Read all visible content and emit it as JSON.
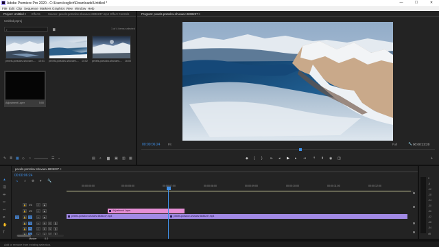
{
  "window": {
    "title": "Adobe Premiere Pro 2020 - C:\\Users\\xxglich\\Downloads\\Untitled *",
    "minimize_glyph": "—",
    "maximize_glyph": "☐",
    "close_glyph": "✕"
  },
  "menu": [
    "File",
    "Edit",
    "Clip",
    "Sequence",
    "Markers",
    "Graphics",
    "View",
    "Window",
    "Help"
  ],
  "project_panel": {
    "tabs": [
      "Project: Untitled ≡",
      "Effects",
      "Source: pexels-porsolov-shuvaev-6836237.mp4",
      "Effect Controls"
    ],
    "project_name": "Untitled.prproj",
    "items_count": "1 of 4 items selected",
    "items": [
      {
        "name": "pexels-porsolov-shuvaev-...",
        "duration": "10:01"
      },
      {
        "name": "pexels-porsolov-shuvaev-...",
        "duration": "14:02"
      },
      {
        "name": "pexels-porsolov-shuvaev-...",
        "duration": "16:00"
      },
      {
        "name": "Adjustment Layer",
        "duration": "5:00"
      }
    ]
  },
  "program_monitor": {
    "tab": "Program: pexels-porsolov-shuvaev-6836237 ≡",
    "timecode_left": "00:00:06:24",
    "fit": "Fit",
    "full": "Full",
    "timecode_right": "00:00:13:20"
  },
  "timeline": {
    "sequence_tab": "pexels-porsolov-shuvaev-6836237 ≡",
    "timecode": "00:00:06:24",
    "ruler_ticks": [
      "00:00:00:00",
      "00:00:05:00",
      "00:00:07:00",
      "00:00:08:00",
      "00:00:09:00",
      "00:00:10:00",
      "00:00:11:00",
      "00:00:12:00"
    ],
    "tracks": [
      {
        "name": "V3",
        "kind": "video"
      },
      {
        "name": "V2",
        "kind": "video"
      },
      {
        "name": "V1",
        "kind": "video"
      },
      {
        "name": "A1",
        "kind": "audio"
      },
      {
        "name": "A2",
        "kind": "audio"
      },
      {
        "name": "A3",
        "kind": "audio"
      }
    ],
    "master_label": "Master",
    "master_value": "0.0",
    "clips": {
      "adjustment": "Adjustment Layer",
      "v1_a": "pexels-porsolov-shuvaev-6836237.mp4",
      "v1_b": "pexels-porsolov-shuvaev-6836237.mp4"
    }
  },
  "tools": [
    "selection-tool",
    "track-select-tool",
    "ripple-edit-tool",
    "razor-tool",
    "slip-tool",
    "pen-tool",
    "hand-tool",
    "type-tool"
  ],
  "meter": {
    "labels": [
      "0",
      "-6",
      "-12",
      "-18",
      "-24",
      "-30",
      "-36",
      "-42",
      "-48",
      "-54",
      "dB"
    ]
  },
  "status": {
    "text": "Add or remove from existing selection."
  },
  "colors": {
    "accent_blue": "#3f8fe6",
    "adjustment_clip": "#e68fd6",
    "video_clip": "#a28ae5"
  }
}
